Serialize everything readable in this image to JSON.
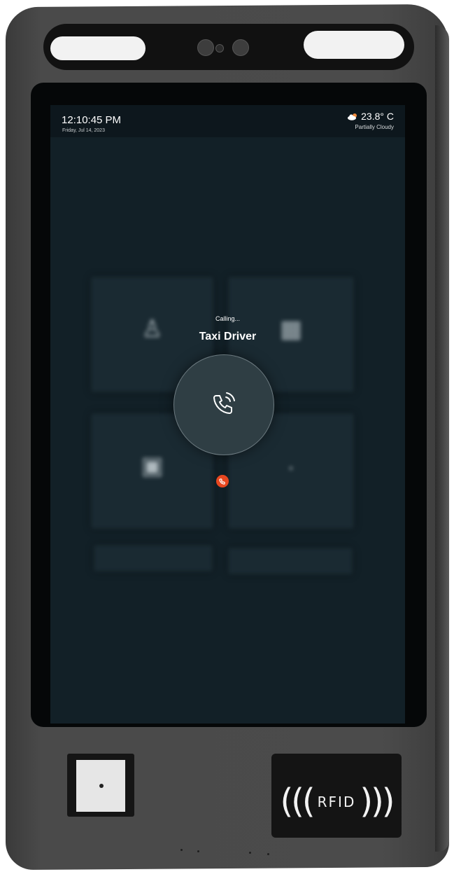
{
  "status_bar": {
    "time": "12:10:45 PM",
    "date": "Friday, Jul 14, 2023",
    "temperature": "23.8° C",
    "weather_condition": "Partially Cloudy",
    "weather_icon": "partly-cloudy-icon"
  },
  "call": {
    "status": "Calling...",
    "callee": "Taxi Driver",
    "call_icon": "phone-ringing-icon",
    "end_icon": "phone-end-icon"
  },
  "hardware": {
    "rfid_label": "RFID"
  },
  "colors": {
    "screen_bg": "#122027",
    "end_call": "#e8471f",
    "call_circle": "#2f3e44"
  }
}
